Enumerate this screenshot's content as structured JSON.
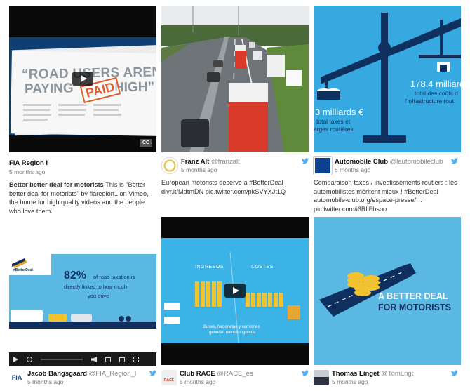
{
  "colors": {
    "accent": "#1da1f2",
    "fiaBlue": "#0b3f8f",
    "twitterBlue": "#55acee"
  },
  "cards": [
    {
      "author": "FIA Region I",
      "handle": "",
      "time": "5 months ago",
      "text_bold": "Better better deal for motorists",
      "text": " This is \"Better better deal for motorists\" by fiaregion1 on Vimeo, the home for high quality videos and the people who love them.",
      "thumb": {
        "headline1": "“ROAD USERS AREN’T",
        "headline2": "PAYING",
        "stamp": "PAID",
        "headline2b": "HIGH”",
        "cc": "CC"
      }
    },
    {
      "author": "Franz Alt",
      "handle": "@franzalt",
      "time": "5 months ago",
      "text": "European motorists deserve a #BetterDeal dlvr.it/MdtmDN pic.twitter.com/pkSVYXJt1Q"
    },
    {
      "author": "Automobile Club",
      "handle": "@lautomobileclub",
      "time": "5 months ago",
      "text": "Comparaison taxes / investissements routiers : les automobilistes méritent mieux ! #BetterDeal automobile-club.org/espace-presse/… pic.twitter.com/i6RliFbsoo",
      "thumb": {
        "left_amount": "3 milliards €",
        "left_caption1": "total taxes et",
        "left_caption2": "arges routières",
        "right_amount": "178,4 milliard",
        "right_caption1": "total des coûts d",
        "right_caption2": "l'infrastructure rout"
      }
    },
    {
      "author": "Jacob Bangsgaard",
      "handle": "@FIA_Region_I",
      "time": "5 months ago",
      "thumb": {
        "percent": "82%",
        "line1": "of road taxation is",
        "line2": "directly linked to how much",
        "line3": "you drive",
        "logo": "A BETTER DEAL FOR MOTORISTS",
        "tag": "#BetterDeal"
      },
      "avatar": "FIA"
    },
    {
      "author": "Club RACE",
      "handle": "@RACE_es",
      "time": "5 months ago",
      "thumb": {
        "label_left": "INGRESOS",
        "label_right": "COSTES",
        "caption1": "Buses, furgonetas y camiones",
        "caption2": "generan menos ingresos"
      },
      "avatar": "RACE"
    },
    {
      "author": "Thomas Linget",
      "handle": "@TomLngt",
      "time": "5 months ago",
      "thumb": {
        "slogan1": "A BETTER DEAL",
        "slogan2": "FOR MOTORISTS"
      }
    }
  ]
}
